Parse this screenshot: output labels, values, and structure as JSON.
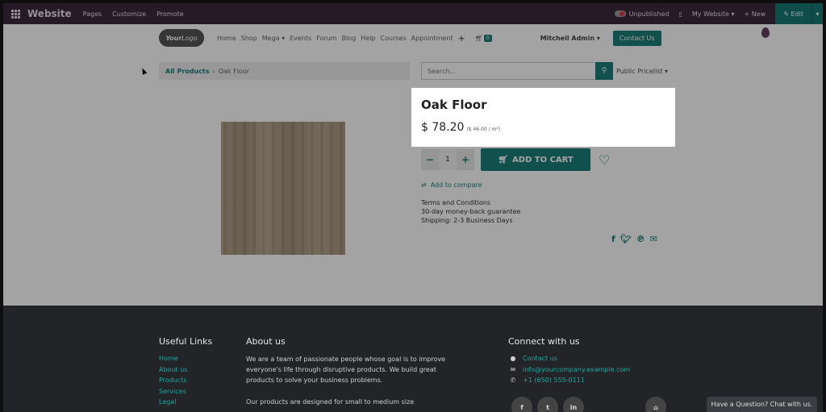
{
  "topbar": {
    "brand": "Website",
    "menu": [
      "Pages",
      "Customize",
      "Promote"
    ],
    "status": "Unpublished",
    "site": "My Website",
    "new": "New",
    "edit": "Edit"
  },
  "header": {
    "logo_left": "Your",
    "logo_right": "Logo",
    "nav": [
      "Home",
      "Shop",
      "Mega",
      "Events",
      "Forum",
      "Blog",
      "Help",
      "Courses",
      "Appointment"
    ],
    "cart_count": "0",
    "user": "Mitchell Admin",
    "contact": "Contact Us"
  },
  "breadcrumb": {
    "root": "All Products",
    "sep": "›",
    "current": "Oak Floor"
  },
  "search": {
    "placeholder": "Search..."
  },
  "pricelist": "Public Pricelist",
  "product": {
    "name": "Oak Floor",
    "price": "$ 78.20",
    "unit_price": "($ 46.00 / m²)",
    "qty": "1",
    "add_to_cart": "ADD TO CART",
    "compare": "Add to compare",
    "terms": [
      "Terms and Conditions",
      "30-day money-back guarantee",
      "Shipping: 2-3 Business Days"
    ]
  },
  "footer": {
    "useful_links_title": "Useful Links",
    "links": [
      "Home",
      "About us",
      "Products",
      "Services",
      "Legal"
    ],
    "about_title": "About us",
    "about_text": "We are a team of passionate people whose goal is to improve everyone's life through disruptive products. We build great products to solve your business problems.",
    "about_text2": "Our products are designed for small to medium size",
    "connect_title": "Connect with us",
    "contacts": [
      "Contact us",
      "info@yourcompany.example.com",
      "+1 (650) 555-0111"
    ],
    "social": [
      "f",
      "t",
      "in"
    ],
    "chat": "Have a Question? Chat with us."
  },
  "colors": {
    "accent": "#1a7f7a",
    "topbar": "#3a2a3a",
    "footer": "#222428"
  }
}
